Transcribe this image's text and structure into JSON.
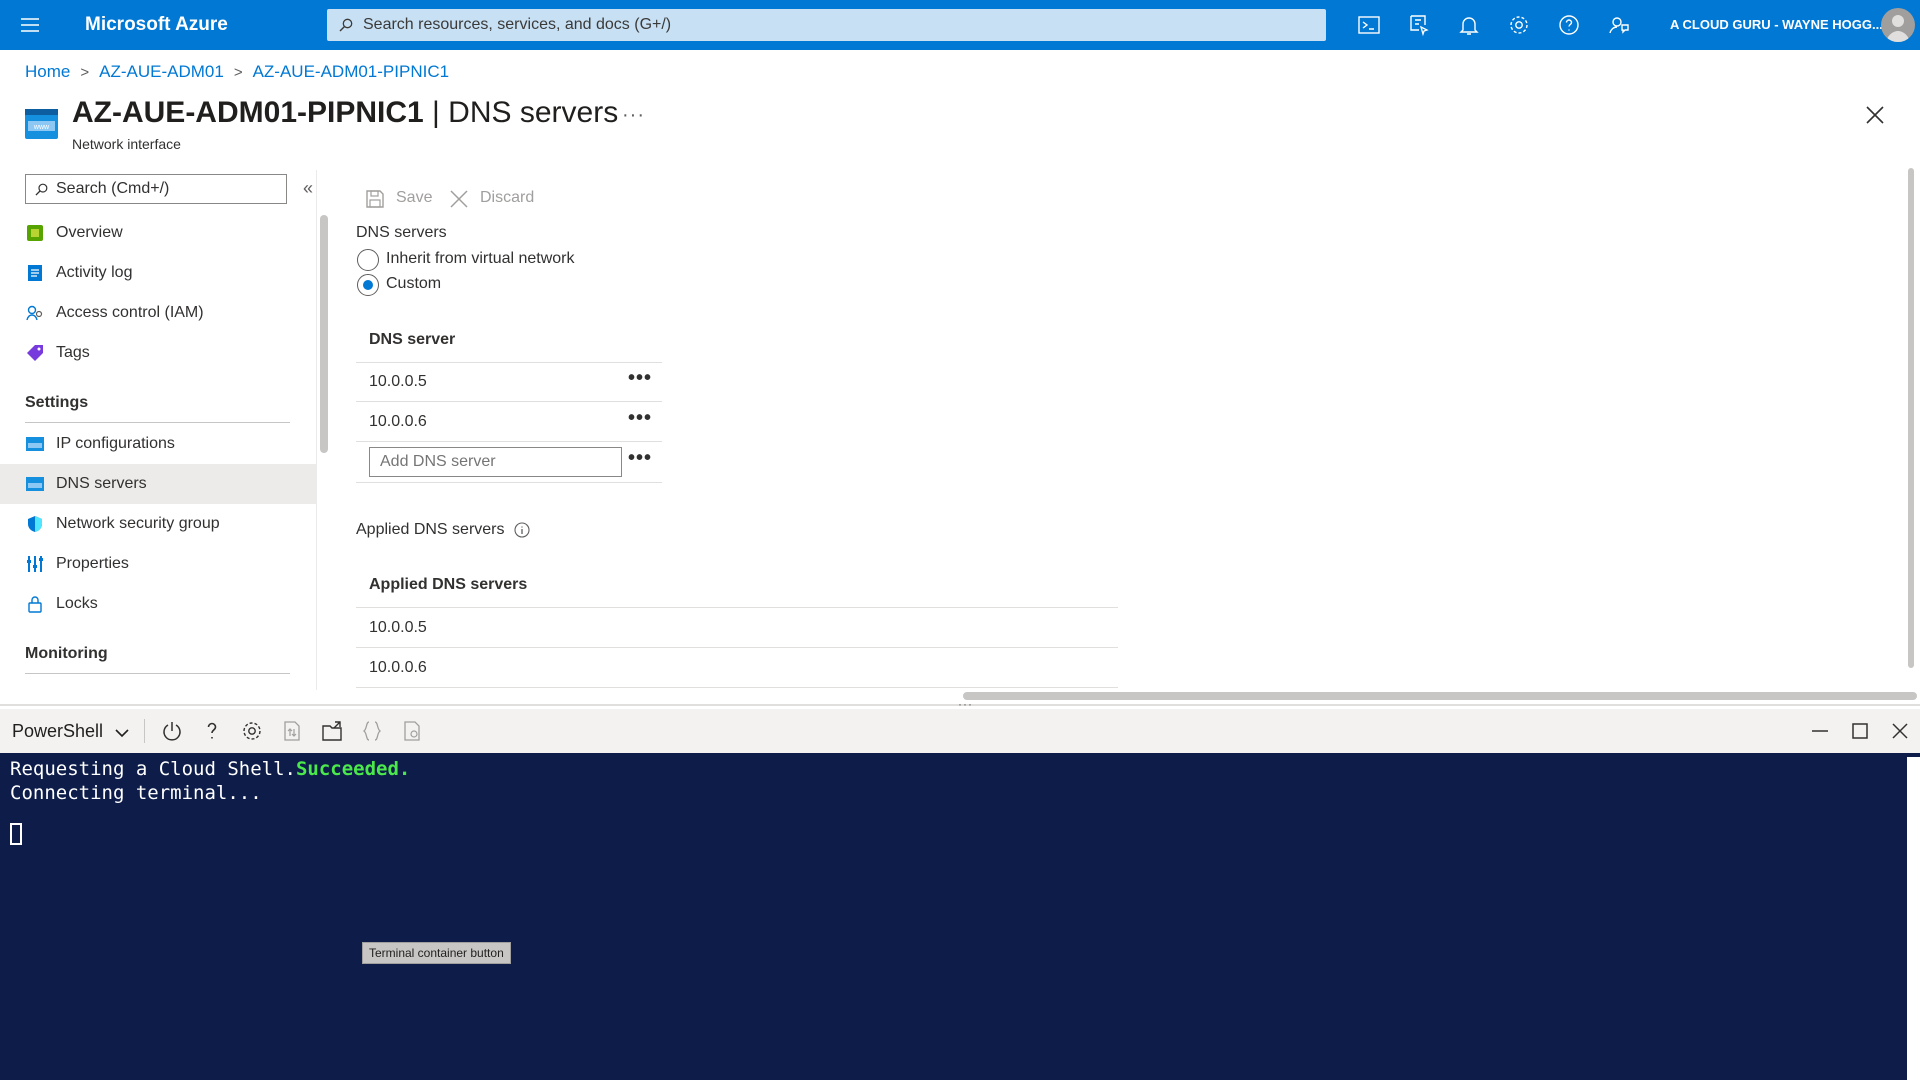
{
  "topbar": {
    "brand": "Microsoft Azure",
    "search_placeholder": "Search resources, services, and docs (G+/)",
    "user": "A CLOUD GURU - WAYNE HOGG...",
    "icons": [
      "cloud-shell-icon",
      "directory-filter-icon",
      "notifications-icon",
      "settings-icon",
      "help-icon",
      "feedback-icon"
    ]
  },
  "breadcrumb": [
    "Home",
    "AZ-AUE-ADM01",
    "AZ-AUE-ADM01-PIPNIC1"
  ],
  "header": {
    "resource": "AZ-AUE-ADM01-PIPNIC1",
    "separator": " | ",
    "page": "DNS servers",
    "subtitle": "Network interface",
    "more": "···"
  },
  "sidebar": {
    "search_placeholder": "Search (Cmd+/)",
    "collapse": "«",
    "items_top": [
      {
        "label": "Overview",
        "icon": "overview-icon"
      },
      {
        "label": "Activity log",
        "icon": "activity-log-icon"
      },
      {
        "label": "Access control (IAM)",
        "icon": "iam-icon"
      },
      {
        "label": "Tags",
        "icon": "tag-icon"
      }
    ],
    "group_settings": "Settings",
    "items_settings": [
      {
        "label": "IP configurations",
        "icon": "ip-config-icon"
      },
      {
        "label": "DNS servers",
        "icon": "dns-icon",
        "selected": true
      },
      {
        "label": "Network security group",
        "icon": "shield-icon"
      },
      {
        "label": "Properties",
        "icon": "properties-icon"
      },
      {
        "label": "Locks",
        "icon": "lock-icon"
      }
    ],
    "group_monitoring": "Monitoring"
  },
  "toolbar": {
    "save": "Save",
    "discard": "Discard"
  },
  "dns": {
    "section_label": "DNS servers",
    "option_inherit": "Inherit from virtual network",
    "option_custom": "Custom",
    "selected": "Custom",
    "grid_header": "DNS server",
    "servers": [
      "10.0.0.5",
      "10.0.0.6"
    ],
    "add_placeholder": "Add DNS server",
    "row_menu": "•••"
  },
  "applied": {
    "section_label": "Applied DNS servers",
    "grid_header": "Applied DNS servers",
    "servers": [
      "10.0.0.5",
      "10.0.0.6"
    ]
  },
  "shell": {
    "type": "PowerShell",
    "line1_prefix": "Requesting a Cloud Shell.",
    "line1_status": "Succeeded.",
    "line2": "Connecting terminal...",
    "tooltip": "Terminal container button",
    "status_color": "#4ae84a"
  },
  "colors": {
    "accent": "#0078d4",
    "terminal_bg": "#0d1c49"
  }
}
